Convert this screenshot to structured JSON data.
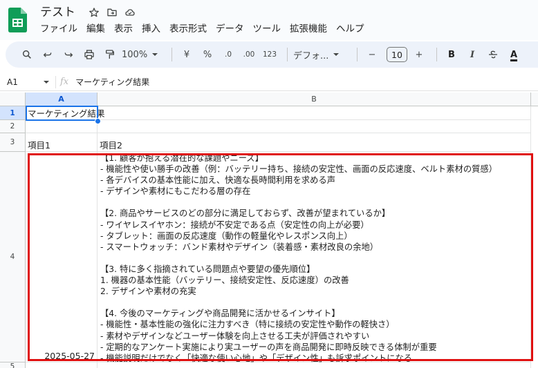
{
  "app": {
    "doc_title": "テスト",
    "title_icons": [
      "star-icon",
      "move-to-folder-icon",
      "cloud-status-icon"
    ],
    "brand_color": "#0f9d58"
  },
  "menu": [
    "ファイル",
    "編集",
    "表示",
    "挿入",
    "表示形式",
    "データ",
    "ツール",
    "拡張機能",
    "ヘルプ"
  ],
  "toolbar": {
    "zoom": "100%",
    "currency": "¥",
    "percent": "%",
    "decrease_decimal": ".0",
    "increase_decimal": ".00",
    "number_format": "123",
    "font": "デフォ...",
    "font_size": "10",
    "minus": "−",
    "plus": "+",
    "bold": "B",
    "italic": "I",
    "text_color_letter": "A"
  },
  "formula_bar": {
    "cell_ref": "A1",
    "fx": "fx",
    "content": "マーケティング結果"
  },
  "sheet": {
    "columns": [
      "A",
      "B"
    ],
    "rows": [
      "1",
      "2",
      "3",
      "4",
      "5"
    ],
    "a1": "マーケティング結果",
    "a3": "項目1",
    "b3": "項目2",
    "a4": "2025-05-27",
    "b4": "【1. 顧客が抱える潜在的な課題やニーズ】\n- 機能性や使い勝手の改善（例：バッテリー持ち、接続の安定性、画面の反応速度、ベルト素材の質感）\n- 各デバイスの基本性能に加え、快適な長時間利用を求める声\n- デザインや素材にもこだわる層の存在\n\n【2. 商品やサービスのどの部分に満足しておらず、改善が望まれているか】\n- ワイヤレスイヤホン：接続が不安定である点（安定性の向上が必要）\n- タブレット：画面の反応速度（動作の軽量化やレスポンス向上）\n- スマートウォッチ：バンド素材やデザイン（装着感・素材改良の余地）\n\n【3. 特に多く指摘されている問題点や要望の優先順位】\n1. 機器の基本性能（バッテリー、接続安定性、反応速度）の改善\n2. デザインや素材の充実\n\n【4. 今後のマーケティングや商品開発に活かせるインサイト】\n- 機能性・基本性能の強化に注力すべき（特に接続の安定性や動作の軽快さ）\n- 素材やデザインなどユーザー体験を向上させる工夫が評価されやすい\n- 定期的なアンケート実施により実ユーザーの声を商品開発に即時反映できる体制が重要\n- 機能説明だけでなく「快適な使い心地」や「デザイン性」も訴求ポイントになる"
  },
  "colors": {
    "selection_blue": "#1a73e8",
    "highlight_red": "#e01010",
    "toolbar_bg": "#edf2fa"
  }
}
